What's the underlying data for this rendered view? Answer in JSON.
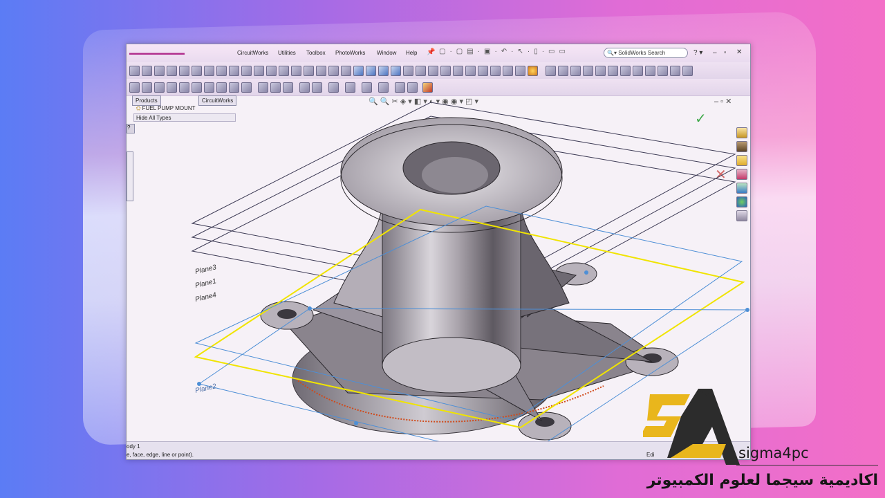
{
  "menu": {
    "items": [
      "CircuitWorks",
      "Utilities",
      "Toolbox",
      "PhotoWorks",
      "Window",
      "Help"
    ]
  },
  "search": {
    "placeholder": "SolidWorks Search"
  },
  "tabs": [
    "Products",
    "CircuitWorks"
  ],
  "tree": {
    "root": "FUEL PUMP MOUNT",
    "filter": "Hide All Types"
  },
  "planes": [
    "Plane3",
    "Plane1",
    "Plane4",
    "Plane2"
  ],
  "status": {
    "left": "ody 1",
    "hint": "e, face, edge, line or point).",
    "right": "Edi"
  },
  "branding": {
    "logo_text": "sigma4pc",
    "arabic_name": "اكاديمية سيجما لعلوم الكمبيوتر"
  },
  "colors": {
    "accent": "#e9b61c",
    "selection": "#f0e400",
    "plane": "#4d8fd6"
  }
}
